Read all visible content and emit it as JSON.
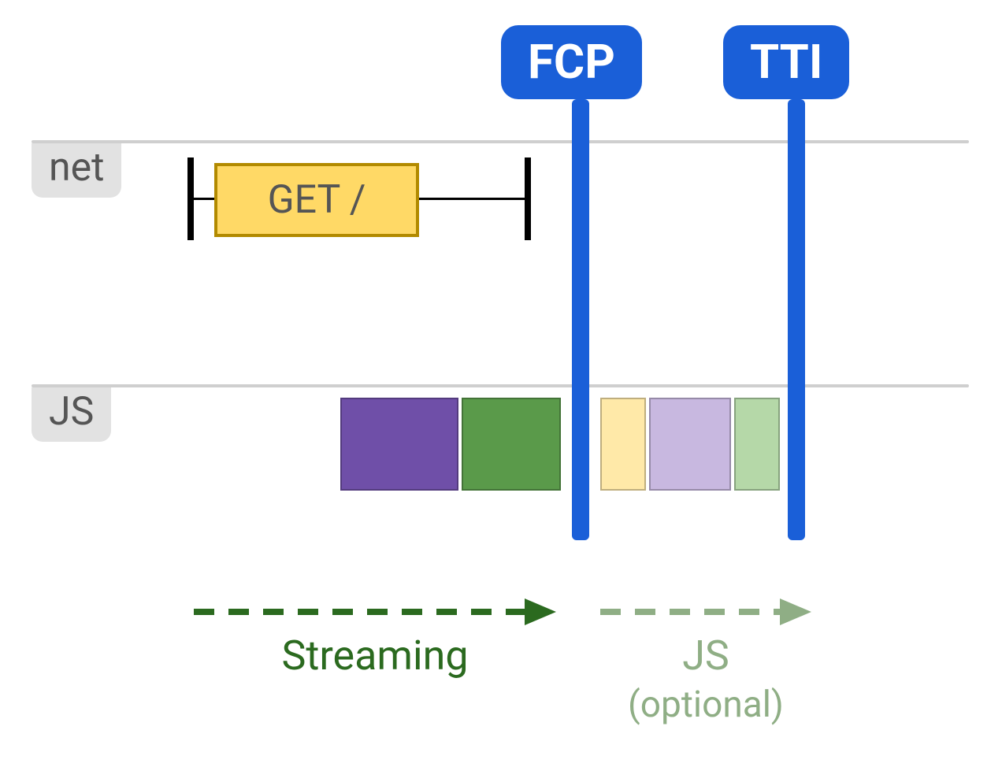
{
  "colors": {
    "marker_bg": "#1a5fd8",
    "track_label_bg": "#e2e2e2",
    "track_line": "#cfcfcf",
    "net_box_fill": "#ffd966",
    "net_box_border": "#b28a00",
    "js_purple": "#6f4fa8",
    "js_green": "#5a9a4a",
    "js_yellow_light": "#ffe9a8",
    "js_purple_light": "#c8b8e0",
    "js_green_light": "#b5d8a8",
    "streaming_arrow": "#2b6a1f",
    "js_arrow": "#8fae85"
  },
  "markers": [
    {
      "id": "fcp",
      "label": "FCP"
    },
    {
      "id": "tti",
      "label": "TTI"
    }
  ],
  "tracks": {
    "net": {
      "label": "net",
      "request_label": "GET /"
    },
    "js": {
      "label": "JS",
      "blocks_before_fcp": [
        "purple",
        "green"
      ],
      "blocks_after_fcp": [
        "yellow_light",
        "purple_light",
        "green_light"
      ]
    }
  },
  "phases": {
    "streaming": {
      "label": "Streaming"
    },
    "js_optional": {
      "label": "JS",
      "sublabel": "(optional)"
    }
  }
}
